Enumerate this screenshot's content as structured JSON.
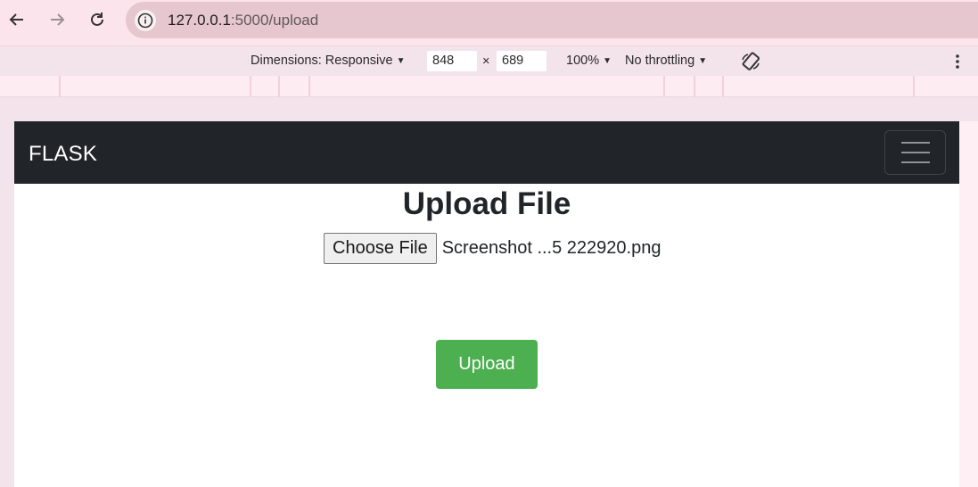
{
  "browser": {
    "url_host": "127.0.0.1",
    "url_path": ":5000/upload",
    "icons": [
      "back-arrow-icon",
      "forward-arrow-icon",
      "reload-icon",
      "info-icon"
    ]
  },
  "device_toolbar": {
    "dimensions_label": "Dimensions: Responsive",
    "width_value": "848",
    "times_symbol": "×",
    "height_value": "689",
    "zoom_label": "100%",
    "throttling_label": "No throttling",
    "caret": "▼",
    "icons": [
      "rotate-icon",
      "more-vertical-icon"
    ]
  },
  "navbar": {
    "brand": "FLASK",
    "background": "#212529",
    "toggler_icon": "hamburger-icon"
  },
  "main": {
    "title": "Upload File",
    "file_input": {
      "button_label": "Choose File",
      "selected_file": "Screenshot ...5 222920.png"
    },
    "upload_button_label": "Upload",
    "upload_button_color": "#4caf50"
  }
}
